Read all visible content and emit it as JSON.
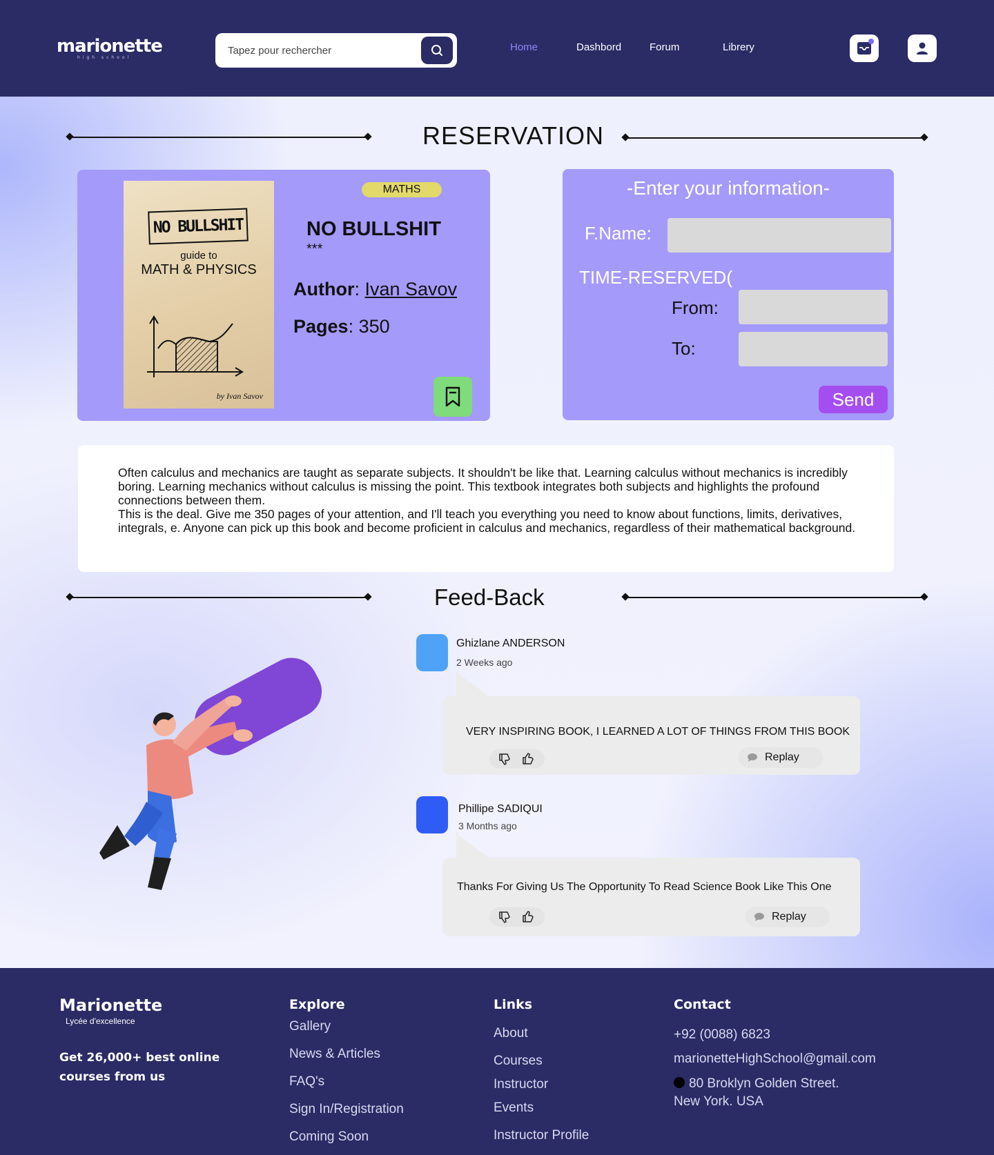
{
  "header": {
    "logo_text": "marionette",
    "logo_subtext": "high school",
    "search_placeholder": "Tapez pour rechercher",
    "nav": [
      {
        "label": "Home",
        "active": true
      },
      {
        "label": "Dashbord",
        "active": false
      },
      {
        "label": "Forum",
        "active": false
      },
      {
        "label": "Librery",
        "active": false
      }
    ],
    "icons": [
      "search-icon",
      "inbox-icon",
      "user-icon"
    ],
    "colors": {
      "brand": "#2b2b66",
      "active_nav": "#8d87f5"
    }
  },
  "reservation": {
    "title": "RESERVATION",
    "book": {
      "cover": {
        "box_text": "NO BULLSHIT",
        "line1": "guide to",
        "line2": "MATH & PHYSICS",
        "author": "by Ivan Savov"
      },
      "category": "MATHS",
      "title": "NO BULLSHIT",
      "stars": "***",
      "author_label": "Author",
      "author": "Ivan Savov",
      "pages_label": "Pages",
      "pages": "350",
      "bookmark_icon": "bookmark-icon"
    },
    "form": {
      "heading": "-Enter your information-",
      "name_label": "F.Name:",
      "time_label": "TIME-RESERVED(",
      "from_label": "From:",
      "to_label": "To:",
      "send_label": "Send",
      "name_value": "",
      "from_value": "",
      "to_value": ""
    },
    "colors": {
      "card": "#a49afa",
      "tag": "#e3d86a",
      "bookmark": "#7fdb7b",
      "send": "#a54ef0"
    }
  },
  "description": {
    "para1": "Often calculus and mechanics are taught as separate subjects. It shouldn't be like that. Learning calculus without mechanics is incredibly boring. Learning mechanics without calculus is missing the point. This textbook integrates both subjects and highlights the profound connections between them.",
    "para2": "This is the deal. Give me 350 pages of your attention, and I'll teach you everything you need to know about functions, limits, derivatives, integrals, e. Anyone can pick up this book and become proficient in calculus and mechanics, regardless of their mathematical background."
  },
  "feedback": {
    "title": "Feed-Back",
    "comments": [
      {
        "name": "Ghizlane ANDERSON",
        "time": "2 Weeks ago",
        "text": "VERY INSPIRING BOOK, I LEARNED A LOT OF THINGS FROM THIS BOOK",
        "reply_label": "Replay",
        "avatar_color": "#4ea3f7"
      },
      {
        "name": "Phillipe SADIQUI",
        "time": "3 Months ago",
        "text": "Thanks For Giving Us The Opportunity To Read Science Book Like This One",
        "reply_label": "Replay",
        "avatar_color": "#2e5cf5"
      }
    ],
    "vote_icons": [
      "thumbs-down-icon",
      "thumbs-up-icon"
    ]
  },
  "footer": {
    "brand": "Marionette",
    "brand_sub": "Lycée d'excellence",
    "tagline": "Get 26,000+ best online courses from us",
    "explore": {
      "title": "Explore",
      "links": [
        "Gallery",
        "News & Articles",
        "FAQ's",
        "Sign In/Registration",
        "Coming Soon"
      ]
    },
    "links": {
      "title": "Links",
      "links": [
        "About",
        "Courses",
        "Instructor",
        "Events",
        "Instructor Profile"
      ]
    },
    "contact": {
      "title": "Contact",
      "phone": "+92 (0088) 6823",
      "email": "marionetteHighSchool@gmail.com",
      "address_line1": "80 Broklyn Golden Street.",
      "address_line2": "New York. USA"
    }
  }
}
